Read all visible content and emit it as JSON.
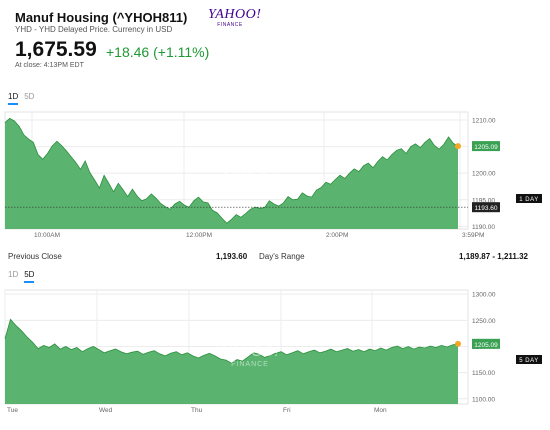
{
  "header": {
    "title": "Manuf Housing (^YHOH811)",
    "subtitle": "YHD - YHD Delayed Price. Currency in USD",
    "logo_brand": "YAHOO!",
    "logo_sub": "FINANCE",
    "price": "1,675.59",
    "change": "+18.46 (+1.11%)",
    "close_time": "At close: 4:13PM EDT"
  },
  "tabs_top": [
    "1D",
    "5D"
  ],
  "tabs_top_active": "1D",
  "tabs_bottom": [
    "1D",
    "5D"
  ],
  "tabs_bottom_active": "5D",
  "stats": {
    "prev_close_label": "Previous Close",
    "prev_close_value": "1,193.60",
    "days_range_label": "Day's Range",
    "days_range_value": "1,189.87 - 1,211.32"
  },
  "colors": {
    "area_fill": "#5ab46f",
    "area_line": "#2c8f3d",
    "last_price_bg": "#3aa153",
    "prev_close_bg": "#222222",
    "dot": "#f5a623",
    "watermark": "#ffffff"
  },
  "watermark": {
    "brand": "YAHOO!",
    "sub": "FINANCE"
  },
  "chart_data": [
    {
      "type": "area",
      "x_ticks": [
        "10:00AM",
        "12:00PM",
        "2:00PM",
        "3:59PM"
      ],
      "y_ticks": [
        "1210.00",
        "1205.00",
        "1200.00",
        "1195.00",
        "1190.00"
      ],
      "ylim": [
        1189.5,
        1211.5
      ],
      "last_price_label": "1205.09",
      "prev_close_line_label": "1193.60",
      "side_label": "1 DAY",
      "last_price": 1205.09,
      "prev_close": 1193.6,
      "values": [
        1209.5,
        1210.3,
        1209.8,
        1208.8,
        1207.2,
        1206.4,
        1205.8,
        1203.5,
        1202.6,
        1203.7,
        1205.1,
        1206.0,
        1205.2,
        1204.2,
        1203.1,
        1202.0,
        1200.7,
        1202.3,
        1200.1,
        1198.7,
        1197.2,
        1199.6,
        1198.1,
        1196.5,
        1198.1,
        1196.9,
        1195.6,
        1197.0,
        1195.7,
        1194.8,
        1195.2,
        1196.1,
        1195.3,
        1194.3,
        1193.7,
        1193.2,
        1194.2,
        1194.7,
        1194.0,
        1193.6,
        1194.8,
        1195.5,
        1194.6,
        1194.4,
        1193.0,
        1192.5,
        1191.5,
        1190.6,
        1191.3,
        1192.2,
        1191.7,
        1192.4,
        1193.2,
        1193.6,
        1193.4,
        1193.5,
        1194.8,
        1194.2,
        1193.8,
        1194.4,
        1195.6,
        1195.0,
        1195.1,
        1196.3,
        1195.7,
        1195.5,
        1196.8,
        1197.3,
        1198.3,
        1197.9,
        1198.8,
        1199.6,
        1199.0,
        1200.0,
        1200.8,
        1200.3,
        1201.4,
        1201.9,
        1201.0,
        1202.2,
        1203.1,
        1202.5,
        1203.5,
        1204.3,
        1204.6,
        1203.7,
        1205.0,
        1205.5,
        1204.8,
        1205.8,
        1206.5,
        1205.2,
        1204.5,
        1205.4,
        1206.8,
        1205.6,
        1205.09
      ]
    },
    {
      "type": "area",
      "x_ticks": [
        "Tue",
        "Wed",
        "Thu",
        "Fri",
        "Mon"
      ],
      "y_ticks": [
        "1300.00",
        "1250.00",
        "1200.00",
        "1150.00",
        "1100.00"
      ],
      "ylim": [
        1090,
        1308
      ],
      "last_price_label": "1205.09",
      "side_label": "5 DAY",
      "last_price": 1205.09,
      "values": [
        1215,
        1252,
        1240,
        1230,
        1218,
        1208,
        1196,
        1202,
        1198,
        1205,
        1195,
        1200,
        1194,
        1198,
        1190,
        1196,
        1200,
        1194,
        1188,
        1192,
        1195,
        1190,
        1186,
        1189,
        1191,
        1185,
        1189,
        1192,
        1186,
        1182,
        1187,
        1190,
        1184,
        1188,
        1182,
        1178,
        1183,
        1187,
        1182,
        1176,
        1174,
        1168,
        1175,
        1172,
        1180,
        1188,
        1185,
        1179,
        1183,
        1187,
        1190,
        1184,
        1188,
        1192,
        1186,
        1190,
        1193,
        1188,
        1191,
        1195,
        1190,
        1193,
        1196,
        1191,
        1194,
        1190,
        1195,
        1192,
        1197,
        1193,
        1198,
        1201,
        1196,
        1200,
        1195,
        1199,
        1197,
        1201,
        1198,
        1202,
        1199,
        1203,
        1205.09
      ]
    }
  ]
}
